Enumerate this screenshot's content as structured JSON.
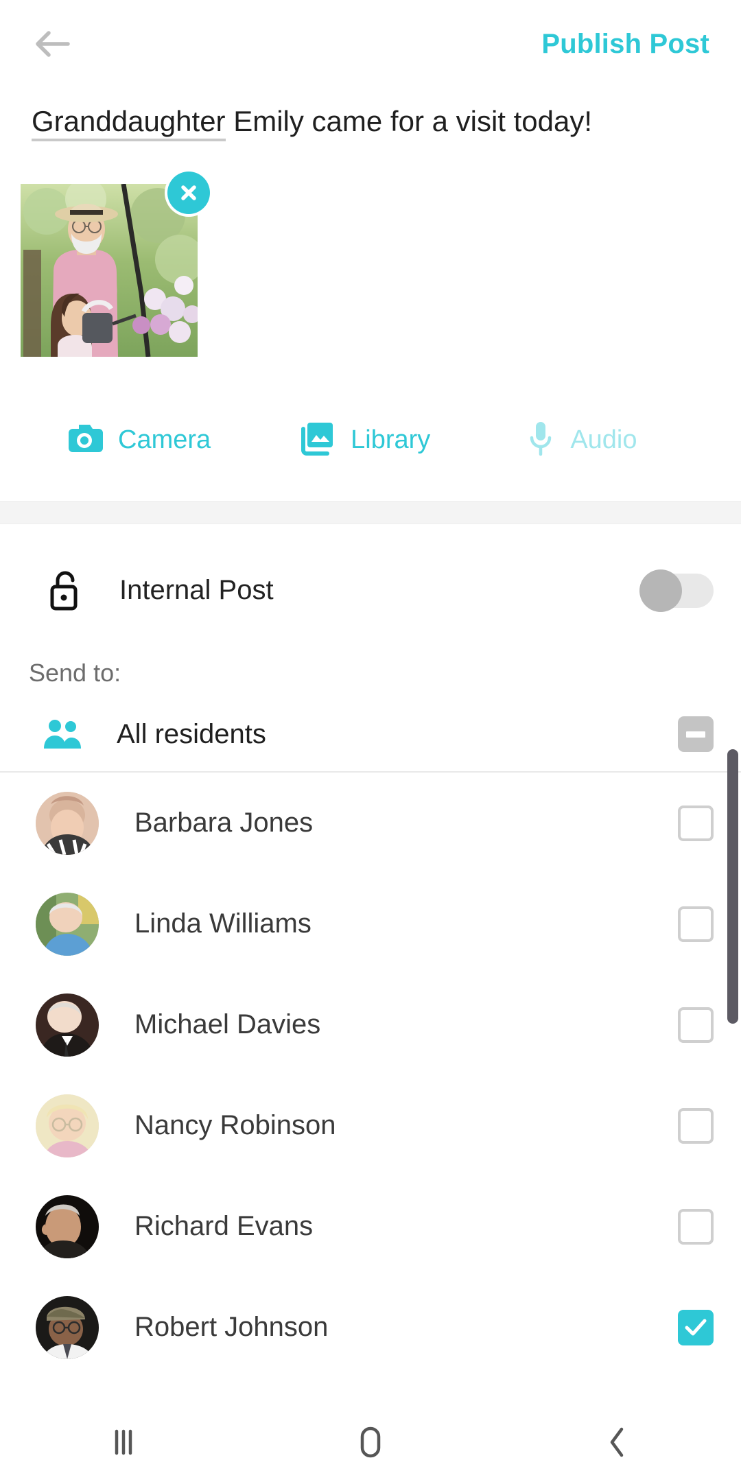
{
  "header": {
    "back_icon": "back-arrow-icon",
    "publish_label": "Publish Post"
  },
  "composer": {
    "text_before": "Granddaughter",
    "text_after": " Emily came for a visit today!",
    "full_text": "Granddaughter Emily came for a visit today!",
    "attachment": {
      "remove_icon": "close-icon",
      "alt": "grandfather in straw hat with granddaughter in garden"
    }
  },
  "media_buttons": [
    {
      "label": "Camera",
      "icon": "camera-icon",
      "enabled": true
    },
    {
      "label": "Library",
      "icon": "image-library-icon",
      "enabled": true
    },
    {
      "label": "Audio",
      "icon": "microphone-icon",
      "enabled": false
    }
  ],
  "settings": {
    "internal_post": {
      "label": "Internal Post",
      "icon": "unlocked-padlock-icon",
      "toggle_state": "off"
    }
  },
  "send_to": {
    "label": "Send to:",
    "all_residents": {
      "label": "All residents",
      "icon": "people-group-icon",
      "checkbox_state": "indeterminate"
    }
  },
  "residents": [
    {
      "name": "Barbara Jones",
      "checked": false
    },
    {
      "name": "Linda Williams",
      "checked": false
    },
    {
      "name": "Michael Davies",
      "checked": false
    },
    {
      "name": "Nancy Robinson",
      "checked": false
    },
    {
      "name": "Richard Evans",
      "checked": false
    },
    {
      "name": "Robert Johnson",
      "checked": true
    }
  ],
  "nav_bar": [
    {
      "name": "recents-button",
      "icon": "recents-icon"
    },
    {
      "name": "home-button",
      "icon": "home-icon"
    },
    {
      "name": "back-button",
      "icon": "back-chevron-icon"
    }
  ],
  "colors": {
    "accent": "#2ec8d6",
    "text_primary": "#1f1f1f",
    "text_secondary": "#6c6c6c",
    "checkbox_border": "#cfcfcf",
    "toggle_off": "#b6b6b6",
    "divider": "#f4f4f4",
    "scrollbar": "#5c5a63"
  }
}
